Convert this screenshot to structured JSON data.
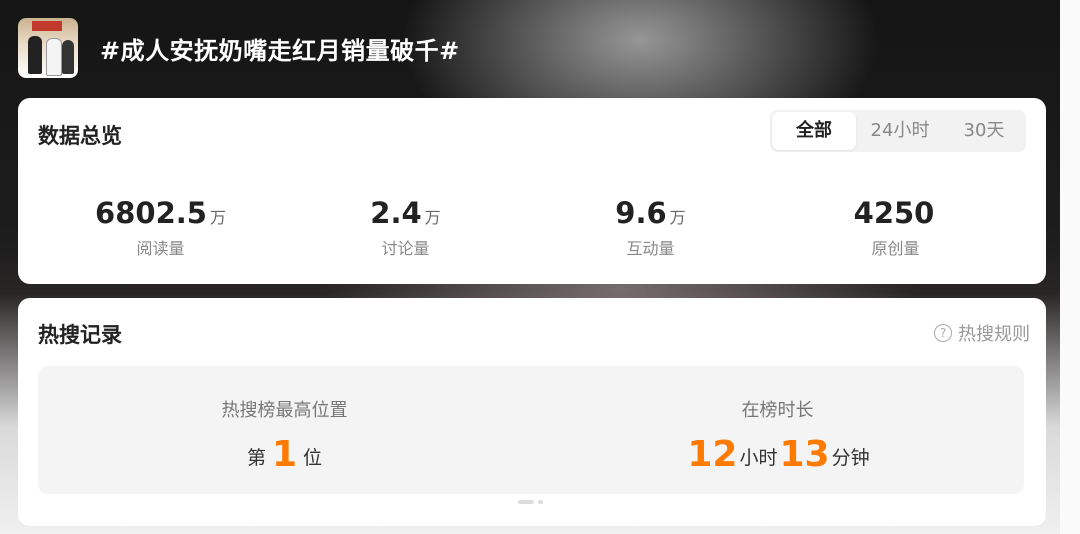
{
  "header": {
    "title": "#成人安抚奶嘴走红月销量破千#"
  },
  "overview": {
    "title": "数据总览",
    "tabs": [
      {
        "label": "全部",
        "active": true
      },
      {
        "label": "24小时",
        "active": false
      },
      {
        "label": "30天",
        "active": false
      }
    ],
    "stats": [
      {
        "value": "6802.5",
        "unit": "万",
        "label": "阅读量"
      },
      {
        "value": "2.4",
        "unit": "万",
        "label": "讨论量"
      },
      {
        "value": "9.6",
        "unit": "万",
        "label": "互动量"
      },
      {
        "value": "4250",
        "unit": "",
        "label": "原创量"
      }
    ]
  },
  "hot": {
    "title": "热搜记录",
    "rules_label": "热搜规则",
    "peak": {
      "label": "热搜榜最高位置",
      "prefix": "第",
      "value": "1",
      "suffix": "位"
    },
    "duration": {
      "label": "在榜时长",
      "hours": "12",
      "hours_unit": "小时",
      "minutes": "13",
      "minutes_unit": "分钟"
    }
  },
  "colors": {
    "accent": "#ff7a00"
  }
}
